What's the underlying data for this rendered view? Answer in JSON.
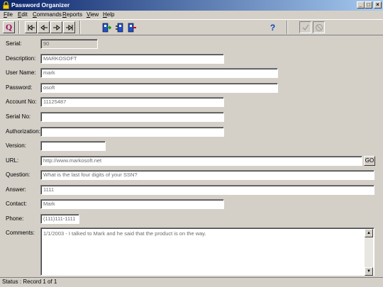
{
  "window": {
    "title": "Password Organizer",
    "minimize_glyph": "_",
    "maximize_glyph": "□",
    "close_glyph": "×"
  },
  "menu": [
    "File",
    "Edit",
    "Commands",
    "Reports",
    "View",
    "Help"
  ],
  "toolbar": {
    "query_label": "Q",
    "help_label": "?",
    "icons": [
      "query-icon",
      "first-record-icon",
      "previous-record-icon",
      "next-record-icon",
      "last-record-icon",
      "add-record-icon",
      "edit-record-icon",
      "delete-record-icon",
      "help-icon",
      "save-icon",
      "cancel-icon"
    ]
  },
  "form": {
    "serial": {
      "label": "Serial:",
      "value": "90"
    },
    "description": {
      "label": "Description:",
      "value": "MARKOSOFT"
    },
    "username": {
      "label": "User Name:",
      "value": "mark"
    },
    "password": {
      "label": "Password:",
      "value": "osoft"
    },
    "account_no": {
      "label": "Account No:",
      "value": "11125487"
    },
    "serial_no": {
      "label": "Serial No:",
      "value": ""
    },
    "authorization": {
      "label": "Authorization:",
      "value": ""
    },
    "version": {
      "label": "Version:",
      "value": ""
    },
    "url": {
      "label": "URL:",
      "value": "http://www.markosoft.net",
      "go_label": "GO"
    },
    "question": {
      "label": "Question:",
      "value": "What is the last four digits of your SSN?"
    },
    "answer": {
      "label": "Answer:",
      "value": "1111"
    },
    "contact": {
      "label": "Contact:",
      "value": "Mark"
    },
    "phone": {
      "label": "Phone:",
      "value": "(111)111-1111"
    },
    "comments": {
      "label": "Comments:",
      "value": "1/1/2003 - I talked to Mark and he said that the product is on the way."
    }
  },
  "status": {
    "text": "Status : Record 1 of 1"
  },
  "colors": {
    "titlebar_start": "#0a246a",
    "titlebar_end": "#a6caf0",
    "face": "#d4d0c8"
  }
}
